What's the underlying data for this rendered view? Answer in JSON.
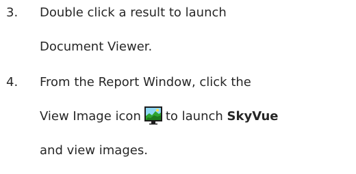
{
  "steps": [
    {
      "number": "3.",
      "lines": [
        "Double click a result to launch",
        "Document Viewer."
      ]
    },
    {
      "number": "4.",
      "line1": "From the Report Window, click the",
      "line2_before_icon": "View Image icon",
      "line2_after_icon": "to launch ",
      "line2_bold": "SkyVue",
      "line3": "and view images.",
      "icon": "view-image-icon"
    }
  ]
}
